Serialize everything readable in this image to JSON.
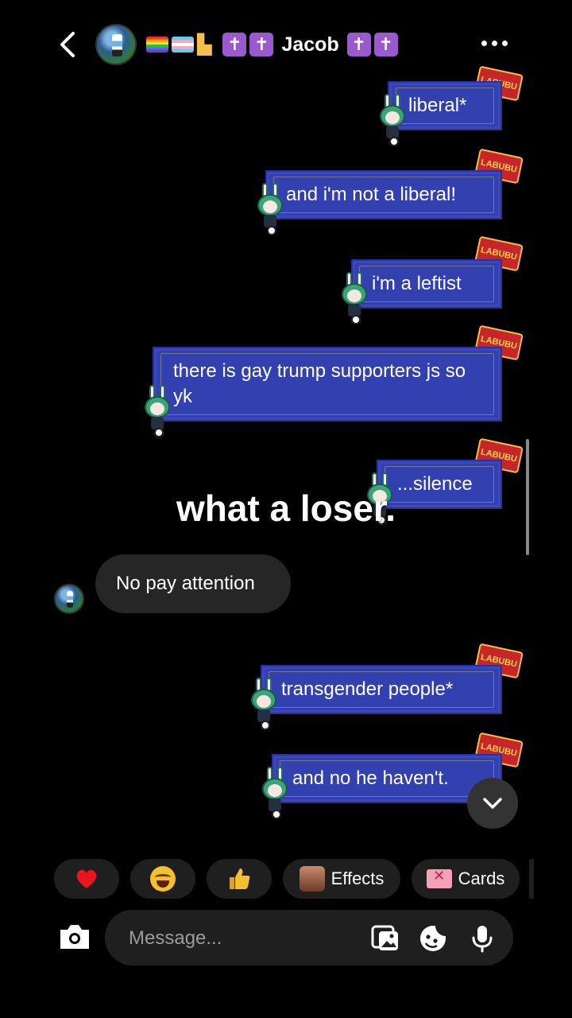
{
  "header": {
    "back_label": "back",
    "flags": [
      "rainbow-flag",
      "trans-flag"
    ],
    "leg_icon": "leg-emoji",
    "name": "Jacob",
    "cross_glyph": "✝",
    "more_label": "more"
  },
  "messages": [
    {
      "text": "liberal*",
      "tag": "LABUBU"
    },
    {
      "text": "and i'm not a liberal!",
      "tag": "LABUBU"
    },
    {
      "text": "i'm a leftist",
      "tag": "LABUBU"
    },
    {
      "text": "there is gay trump supporters  js so yk",
      "tag": "LABUBU"
    },
    {
      "text": "...silence",
      "tag": "LABUBU"
    },
    {
      "text": "No pay attention"
    },
    {
      "text": "transgender people*",
      "tag": "LABUBU"
    },
    {
      "text": "and no he haven't.",
      "tag": "LABUBU"
    }
  ],
  "overlay_caption": "what a loser.",
  "quick_reactions": {
    "heart": "heart-emoji",
    "laugh": "tears-of-joy-emoji",
    "thumb": "thumbs-up-emoji",
    "effects_label": "Effects",
    "cards_label": "Cards"
  },
  "composer": {
    "placeholder": "Message..."
  },
  "colors": {
    "bubble": "#3340b0",
    "inbound": "#262626",
    "background": "#000000"
  }
}
